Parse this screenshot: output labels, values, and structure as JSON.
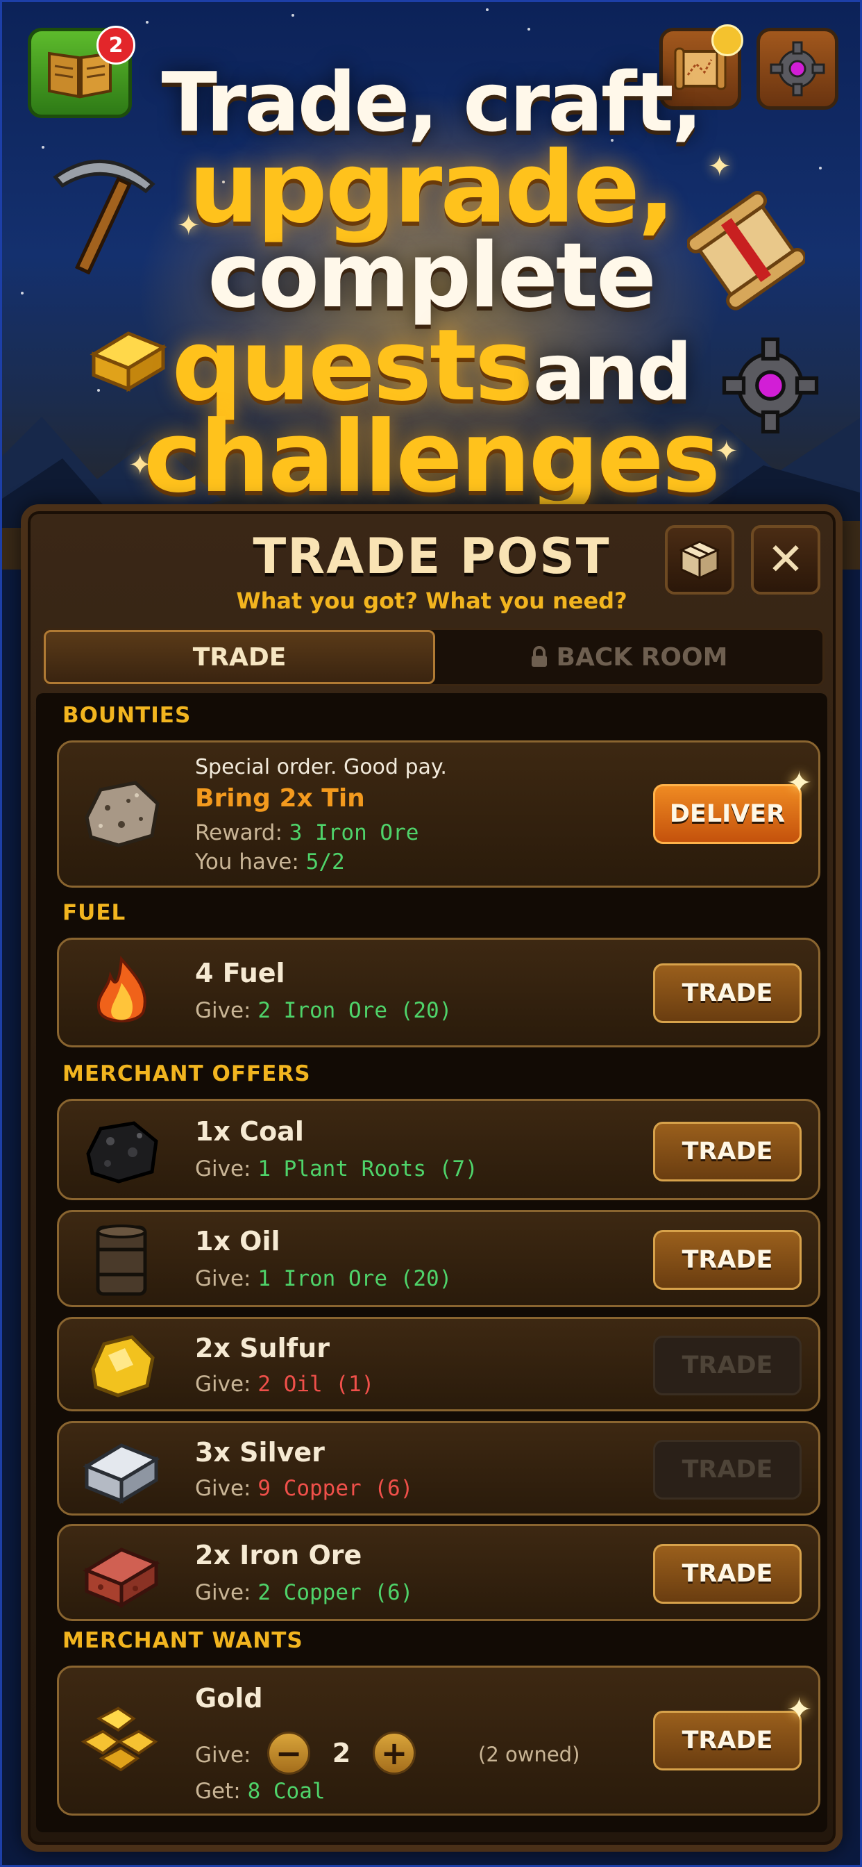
{
  "top_bar": {
    "journal_badge": "2",
    "icons": [
      "book-icon",
      "map-scroll-icon",
      "gear-icon"
    ]
  },
  "headline": {
    "line1": "Trade, craft,",
    "line2": "upgrade,",
    "line3": "complete",
    "line4a": "quests",
    "line4b": "and",
    "line5": "challenges"
  },
  "panel": {
    "title": "TRADE POST",
    "subtitle": "What you got? What you need?",
    "close_label": "✕"
  },
  "tabs": [
    {
      "label": "TRADE",
      "active": true
    },
    {
      "label": "BACK ROOM",
      "active": false,
      "icon": "lock-icon"
    }
  ],
  "sections": {
    "bounties": "BOUNTIES",
    "fuel": "FUEL",
    "merchant_offers": "MERCHANT  OFFERS",
    "merchant_wants": "MERCHANT  WANTS"
  },
  "bounty": {
    "tagline": "Special order. Good pay.",
    "title": "Bring 2x Tin",
    "reward_label": "Reward:",
    "reward_value": "3 Iron Ore",
    "have_label": "You have:",
    "have_value": "5/2",
    "button": "DELIVER",
    "icon": "tin-ore-icon"
  },
  "fuel": {
    "title": "4 Fuel",
    "give_label": "Give:",
    "give_value": "2 Iron Ore (20)",
    "button": "TRADE",
    "icon": "fire-icon"
  },
  "offers": [
    {
      "title": "1x Coal",
      "give_label": "Give:",
      "give_value": "1 Plant Roots (7)",
      "affordable": true,
      "button": "TRADE",
      "icon": "coal-icon"
    },
    {
      "title": "1x Oil",
      "give_label": "Give:",
      "give_value": "1 Iron Ore (20)",
      "affordable": true,
      "button": "TRADE",
      "icon": "oil-barrel-icon"
    },
    {
      "title": "2x Sulfur",
      "give_label": "Give:",
      "give_value": "2 Oil (1)",
      "affordable": false,
      "button": "TRADE",
      "icon": "sulfur-icon"
    },
    {
      "title": "3x Silver",
      "give_label": "Give:",
      "give_value": "9 Copper (6)",
      "affordable": false,
      "button": "TRADE",
      "icon": "silver-ingot-icon"
    },
    {
      "title": "2x Iron Ore",
      "give_label": "Give:",
      "give_value": "2 Copper (6)",
      "affordable": true,
      "button": "TRADE",
      "icon": "iron-ore-icon"
    }
  ],
  "want": {
    "title": "Gold",
    "give_label": "Give:",
    "quantity": "2",
    "owned": "(2 owned)",
    "get_label": "Get:",
    "get_value": "8 Coal",
    "button": "TRADE",
    "icon": "gold-nuggets-icon"
  },
  "colors": {
    "accent_gold": "#f2b51f",
    "positive": "#4fd36a",
    "negative": "#f0504a",
    "deliver_orange": "#ef8a22"
  }
}
